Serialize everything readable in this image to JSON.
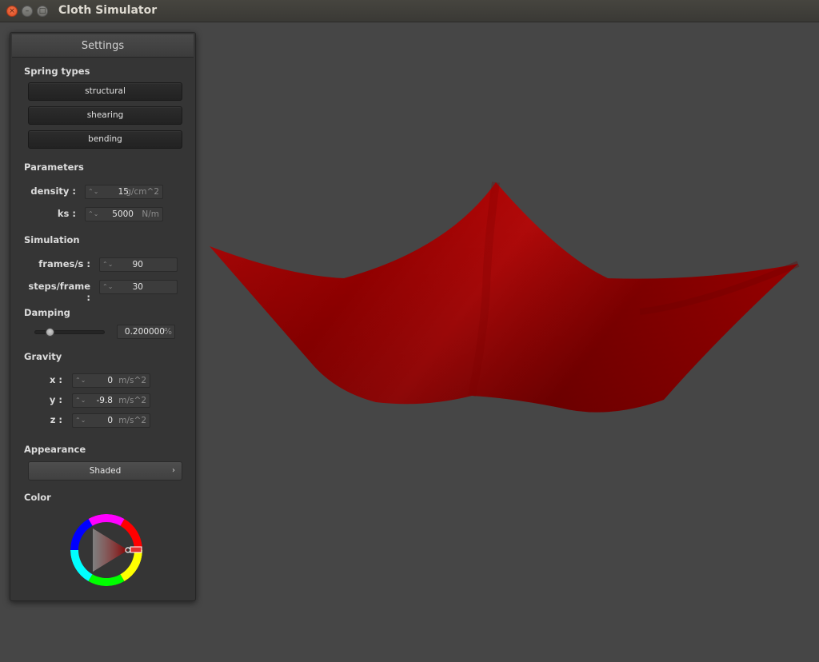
{
  "window": {
    "title": "Cloth Simulator"
  },
  "settings": {
    "title": "Settings",
    "spring_types": {
      "label": "Spring types",
      "buttons": [
        "structural",
        "shearing",
        "bending"
      ]
    },
    "parameters": {
      "label": "Parameters",
      "density": {
        "label": "density :",
        "value": "15",
        "unit": "g/cm^2"
      },
      "ks": {
        "label": "ks :",
        "value": "5000",
        "unit": "N/m"
      }
    },
    "simulation": {
      "label": "Simulation",
      "fps": {
        "label": "frames/s :",
        "value": "90"
      },
      "steps": {
        "label": "steps/frame :",
        "value": "30"
      }
    },
    "damping": {
      "label": "Damping",
      "value": "0.200000",
      "unit": "%",
      "slider_fraction": 0.2
    },
    "gravity": {
      "label": "Gravity",
      "x": {
        "label": "x :",
        "value": "0",
        "unit": "m/s^2"
      },
      "y": {
        "label": "y :",
        "value": "-9.8",
        "unit": "m/s^2"
      },
      "z": {
        "label": "z :",
        "value": "0",
        "unit": "m/s^2"
      }
    },
    "appearance": {
      "label": "Appearance",
      "selected": "Shaded"
    },
    "color": {
      "label": "Color",
      "value": "#cc0000"
    }
  },
  "colors": {
    "cloth": "#a80000",
    "background": "#464646"
  }
}
